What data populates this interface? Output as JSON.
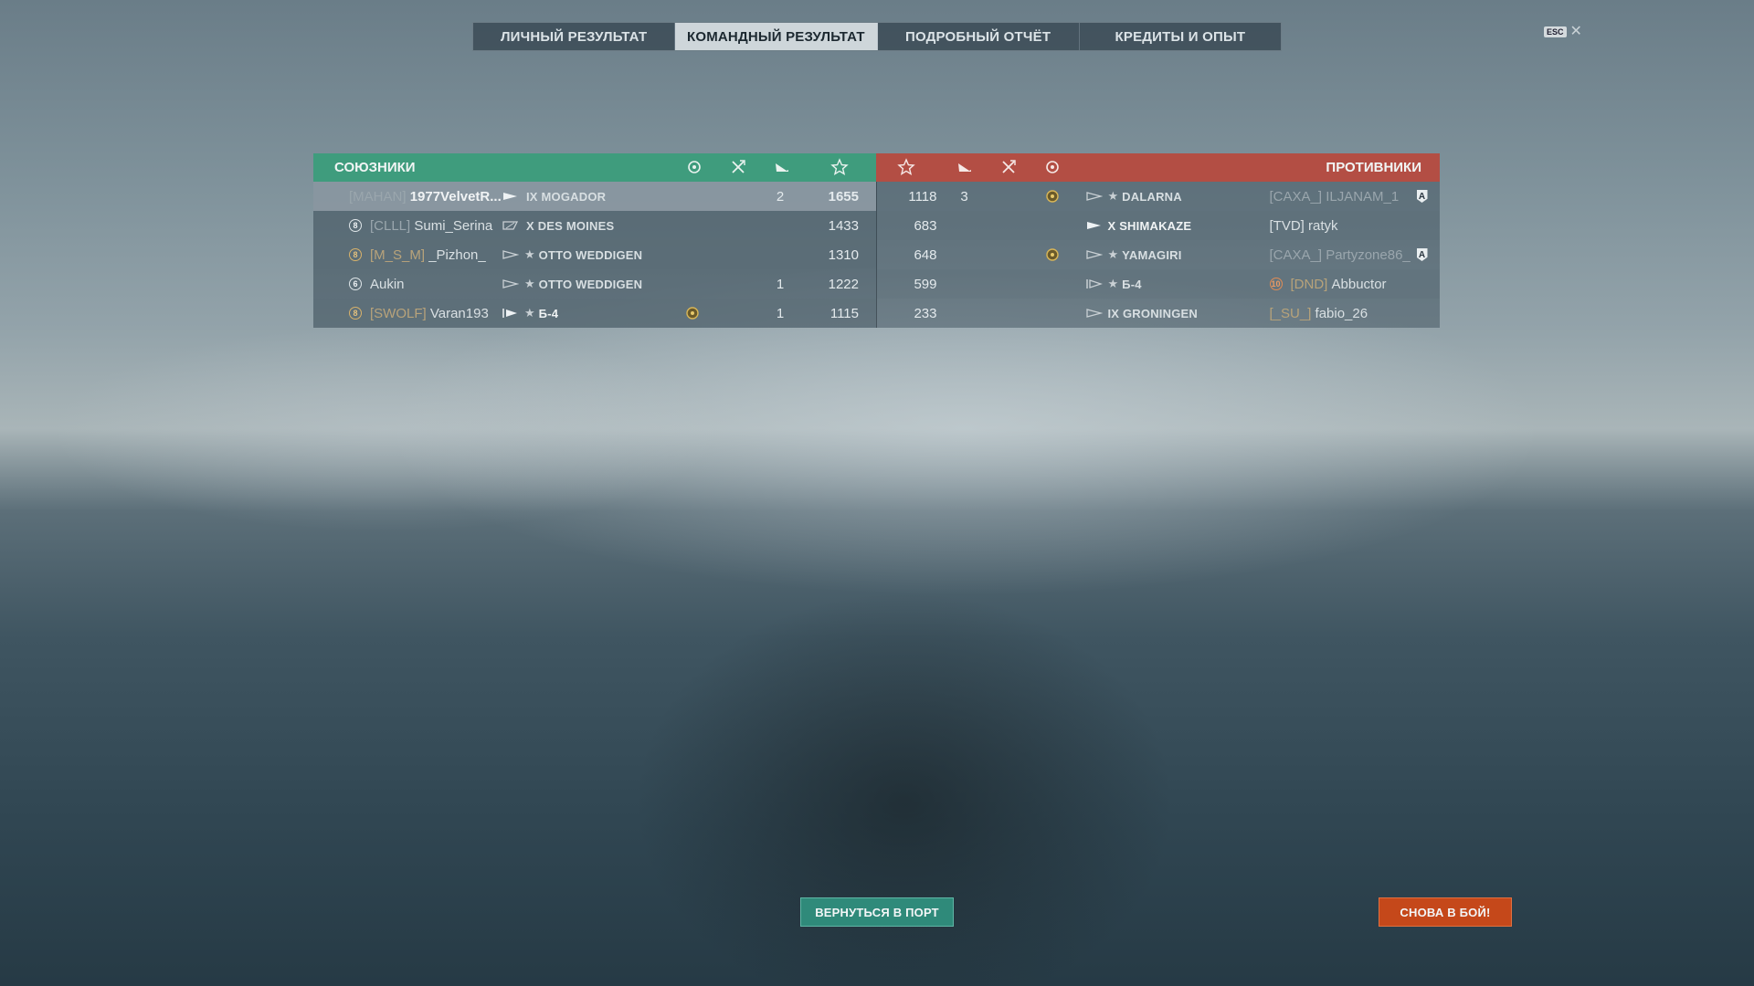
{
  "tabs": [
    {
      "label": "ЛИЧНЫЙ РЕЗУЛЬТАТ",
      "active": false
    },
    {
      "label": "КОМАНДНЫЙ РЕЗУЛЬТАТ",
      "active": true
    },
    {
      "label": "ПОДРОБНЫЙ ОТЧЁТ",
      "active": false
    },
    {
      "label": "КРЕДИТЫ И ОПЫТ",
      "active": false
    }
  ],
  "esc": {
    "key_label": "ESC",
    "close_glyph": "✕"
  },
  "allies": {
    "title": "СОЮЗНИКИ",
    "column_icons": [
      "medal-icon",
      "planes-shot-icon",
      "ships-destroyed-icon",
      "experience-star-icon"
    ],
    "players": [
      {
        "rank": "",
        "clan": "[MAHAN]",
        "name": "1977VelvetR...",
        "tier": "IX",
        "ship": "MOGADOR",
        "premium": false,
        "medal": false,
        "kills": "2",
        "exp": "1655"
      },
      {
        "rank": "8",
        "clan": "[CLLL]",
        "name": "Sumi_Serina",
        "tier": "X",
        "ship": "DES MOINES",
        "premium": false,
        "medal": false,
        "kills": "",
        "exp": "1433"
      },
      {
        "rank": "8",
        "clan": "[M_S_M]",
        "name": "_Pizhon_",
        "tier": "",
        "ship": "OTTO WEDDIGEN",
        "premium": true,
        "medal": false,
        "kills": "",
        "exp": "1310"
      },
      {
        "rank": "6",
        "clan": "",
        "name": "Aukin",
        "tier": "",
        "ship": "OTTO WEDDIGEN",
        "premium": true,
        "medal": false,
        "kills": "1",
        "exp": "1222"
      },
      {
        "rank": "8",
        "clan": "[SWOLF]",
        "name": "Varan193",
        "tier": "",
        "ship": "Б-4",
        "premium": true,
        "medal": true,
        "kills": "1",
        "exp": "1115"
      }
    ]
  },
  "enemies": {
    "title": "ПРОТИВНИКИ",
    "column_icons": [
      "experience-star-icon",
      "ships-destroyed-icon",
      "planes-shot-icon",
      "medal-icon"
    ],
    "players": [
      {
        "exp": "1118",
        "kills": "3",
        "medal": true,
        "tier": "",
        "ship": "DALARNA",
        "premium": true,
        "clan": "[CAXA_]",
        "name": "ILJANAM_1",
        "rank": "",
        "badge": "A"
      },
      {
        "exp": "683",
        "kills": "",
        "medal": false,
        "tier": "X",
        "ship": "SHIMAKAZE",
        "premium": false,
        "clan": "[TVD]",
        "name": "ratyk",
        "rank": "",
        "badge": ""
      },
      {
        "exp": "648",
        "kills": "",
        "medal": true,
        "tier": "",
        "ship": "YAMAGIRI",
        "premium": true,
        "clan": "[CAXA_]",
        "name": "Partyzone86_",
        "rank": "",
        "badge": "A"
      },
      {
        "exp": "599",
        "kills": "",
        "medal": false,
        "tier": "",
        "ship": "Б-4",
        "premium": true,
        "clan": "[DND]",
        "name": "Abbuctor",
        "rank": "10",
        "badge": ""
      },
      {
        "exp": "233",
        "kills": "",
        "medal": false,
        "tier": "IX",
        "ship": "GRONINGEN",
        "premium": false,
        "clan": "[_SU_]",
        "name": "fabio_26",
        "rank": "",
        "badge": ""
      }
    ]
  },
  "buttons": {
    "port": "ВЕРНУТЬСЯ В ПОРТ",
    "battle": "СНОВА В БОЙ!"
  },
  "colors": {
    "allies": "#3f9c7d",
    "enemies": "#b34e44",
    "port_button": "#2f8a7a",
    "battle_button": "#c5481a"
  }
}
